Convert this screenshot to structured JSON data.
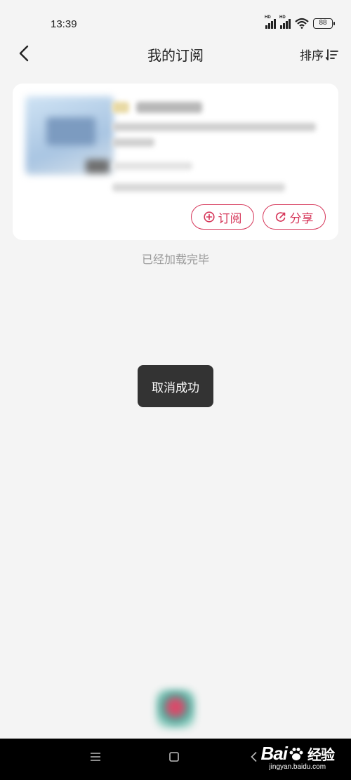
{
  "status_bar": {
    "time": "13:39",
    "battery": "88"
  },
  "header": {
    "title": "我的订阅",
    "sort_label": "排序"
  },
  "card": {
    "subscribe_label": "订阅",
    "share_label": "分享"
  },
  "load_end_text": "已经加载完毕",
  "toast": {
    "text": "取消成功"
  },
  "watermark": {
    "logo_text": "Bai",
    "logo_suffix": "经验",
    "url": "jingyan.baidu.com"
  },
  "colors": {
    "accent": "#d6375a",
    "background": "#f4f4f4",
    "toast_bg": "#333333"
  }
}
